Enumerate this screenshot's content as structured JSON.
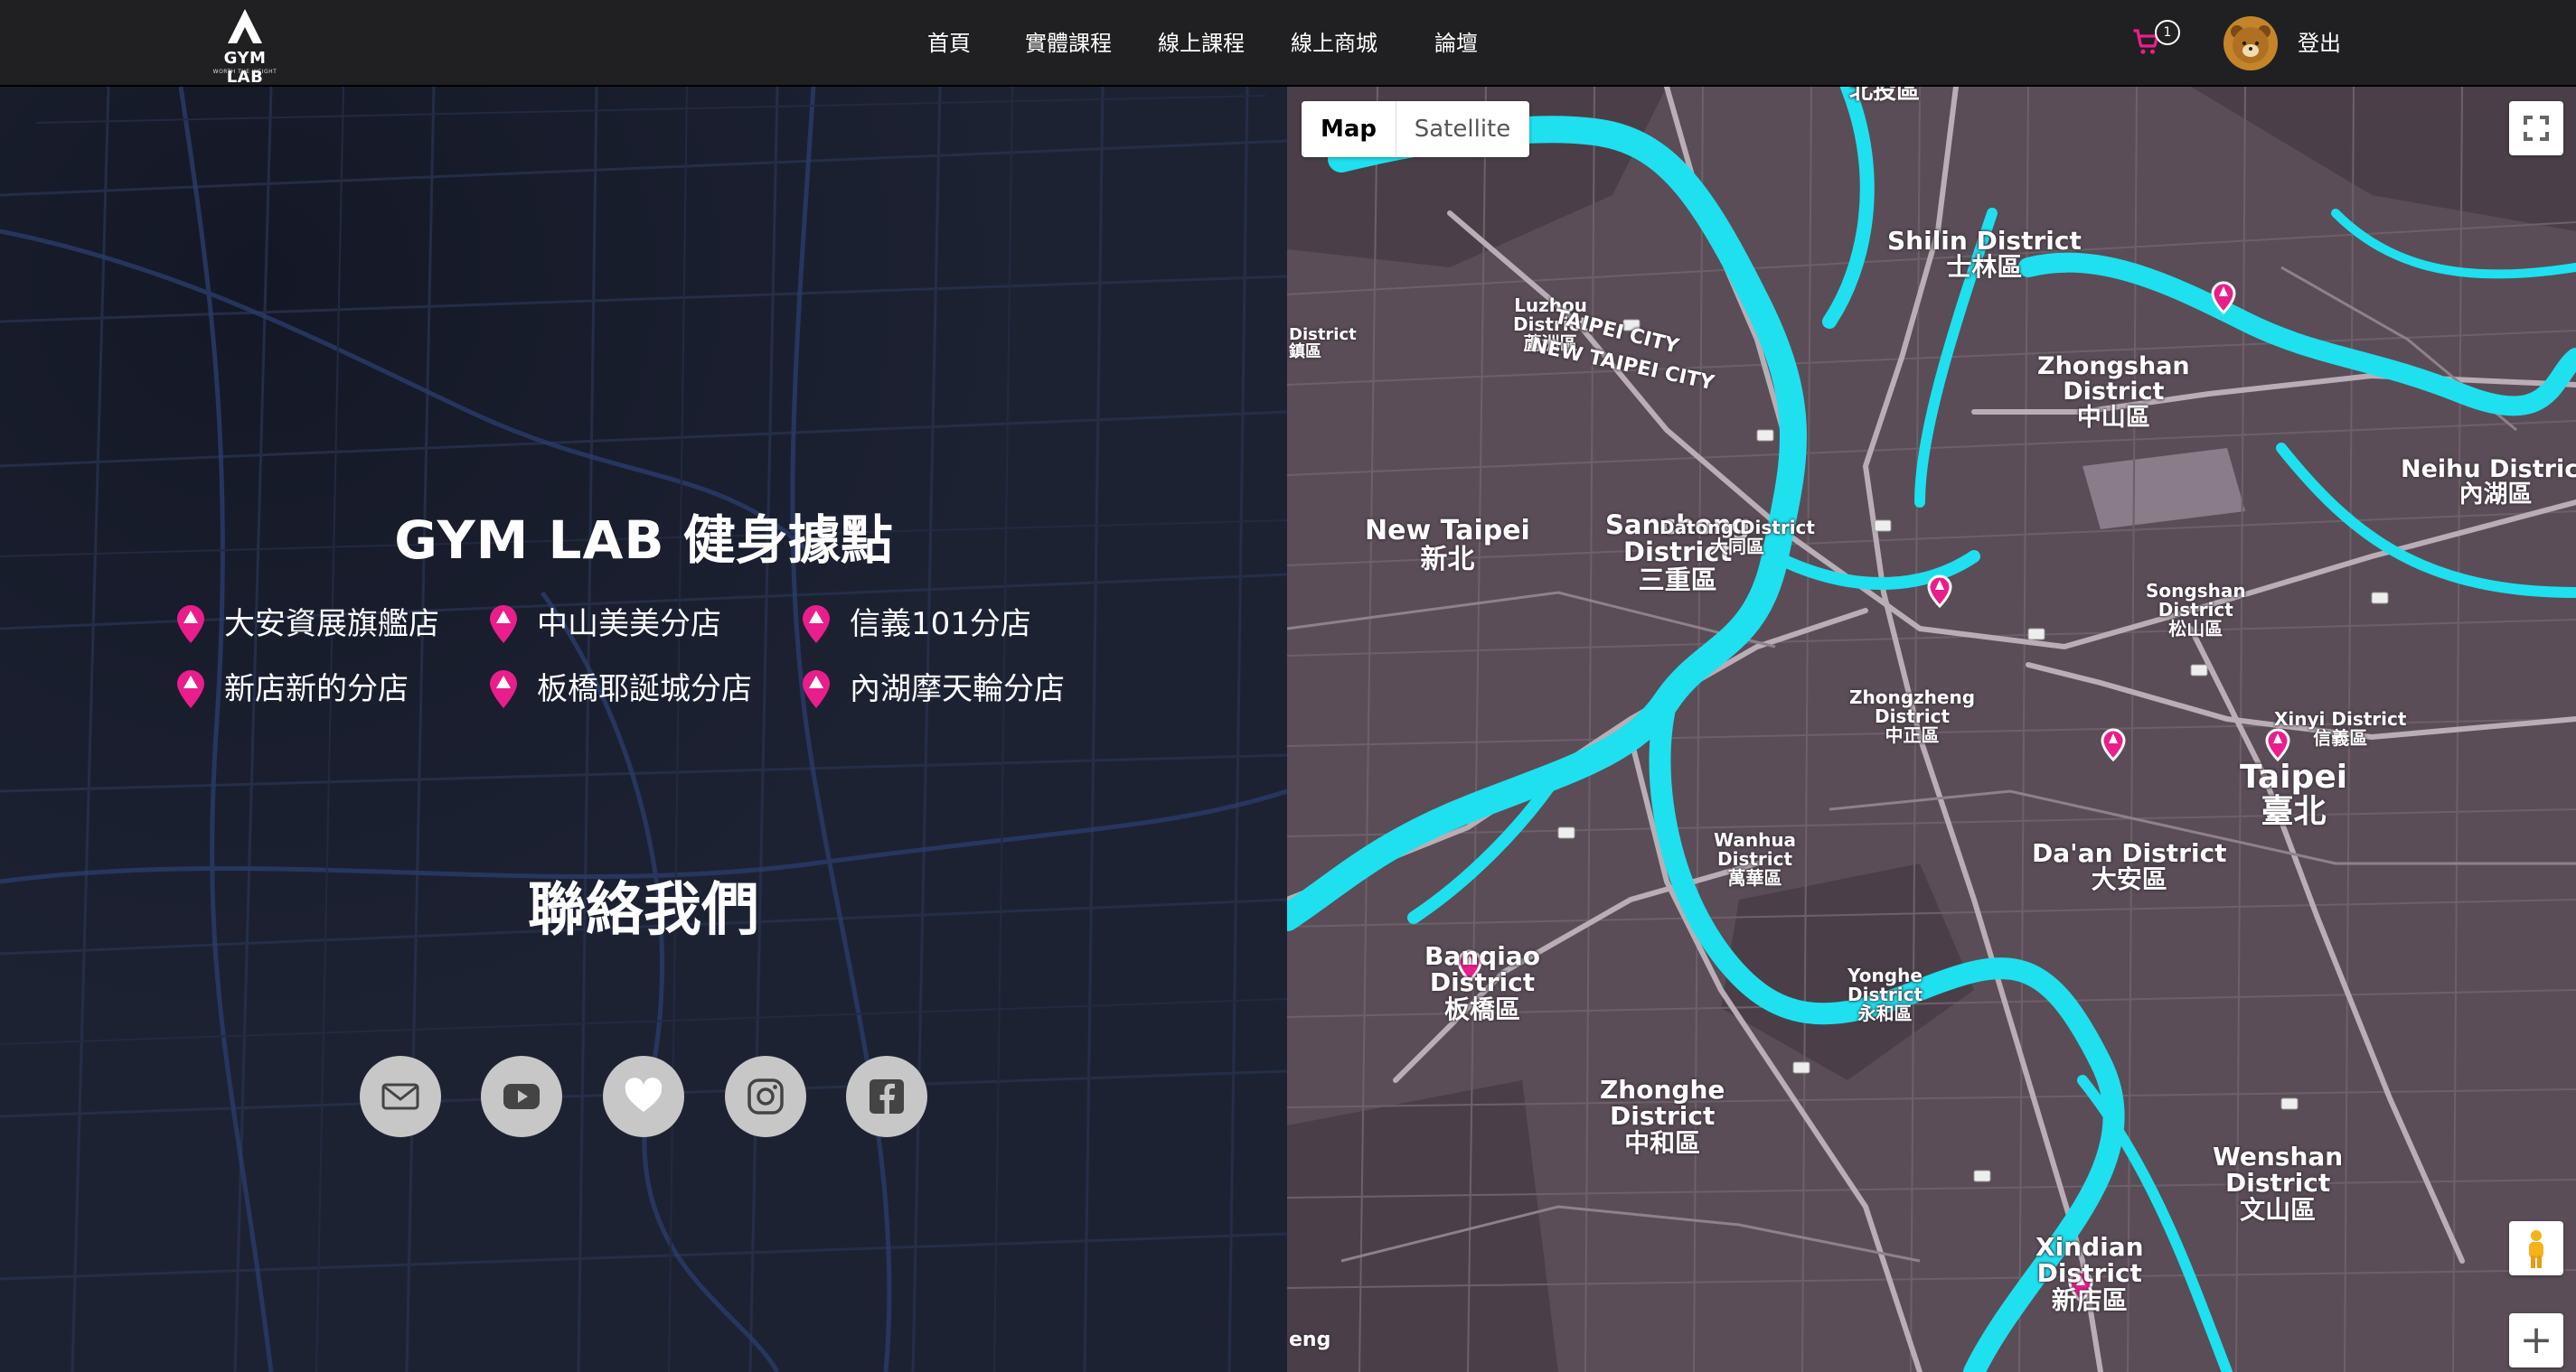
{
  "brand": {
    "name": "GYM LAB",
    "tagline": "WORTH THE WEIGHT"
  },
  "nav": {
    "items": [
      "首頁",
      "實體課程",
      "線上課程",
      "線上商城",
      "論壇"
    ],
    "cart_count": "1",
    "logout_label": "登出"
  },
  "locations": {
    "title_brand": "GYM LAB",
    "title_rest": " 健身據點",
    "branches": [
      "大安資展旗艦店",
      "中山美美分店",
      "信義101分店",
      "新店新的分店",
      "板橋耶誕城分店",
      "內湖摩天輪分店"
    ]
  },
  "contact": {
    "title": "聯絡我們",
    "icons": [
      "mail-icon",
      "youtube-icon",
      "heart-icon",
      "instagram-icon",
      "facebook-icon"
    ]
  },
  "map": {
    "type_options": [
      "Map",
      "Satellite"
    ],
    "selected_type": "Map",
    "zoom_in_label": "+",
    "labels": {
      "beitou": "北投區",
      "shilin": "Shilin District\n士林區",
      "zhongshan": "Zhongshan\nDistrict\n中山區",
      "neihu": "Neihu District\n內湖區",
      "luzhou": "Luzhou\nDistrict\n蘆洲區",
      "newtaipei": "New Taipei\n新北",
      "sanchong": "Sanchong\nDistrict\n三重區",
      "datong": "Datong District\n大同區",
      "songshan": "Songshan\nDistrict\n松山區",
      "zhongzheng": "Zhongzheng\nDistrict\n中正區",
      "xinyi": "Xinyi District\n信義區",
      "taipei": "Taipei\n臺北",
      "wanhua": "Wanhua\nDistrict\n萬華區",
      "daan": "Da'an District\n大安區",
      "banqiao": "Banqiao\nDistrict\n板橋區",
      "yonghe": "Yonghe\nDistrict\n永和區",
      "zhonghe": "Zhonghe\nDistrict\n中和區",
      "wenshan": "Wenshan\nDistrict\n文山區",
      "xindian": "Xindian\nDistrict\n新店區",
      "taipeicity1": "TAIPEI CITY",
      "newtaipeicity1": "NEW TAIPEI CITY",
      "leftdistrict": "District\n鎮區",
      "bottomleft": "eng"
    }
  },
  "colors": {
    "navbar": "#202022",
    "left_bg": "#1a1e2e",
    "map_land": "#5a4d58",
    "river": "#1fe0ee",
    "pin": "#e91e8c",
    "social_bg": "#c7c7c7"
  }
}
